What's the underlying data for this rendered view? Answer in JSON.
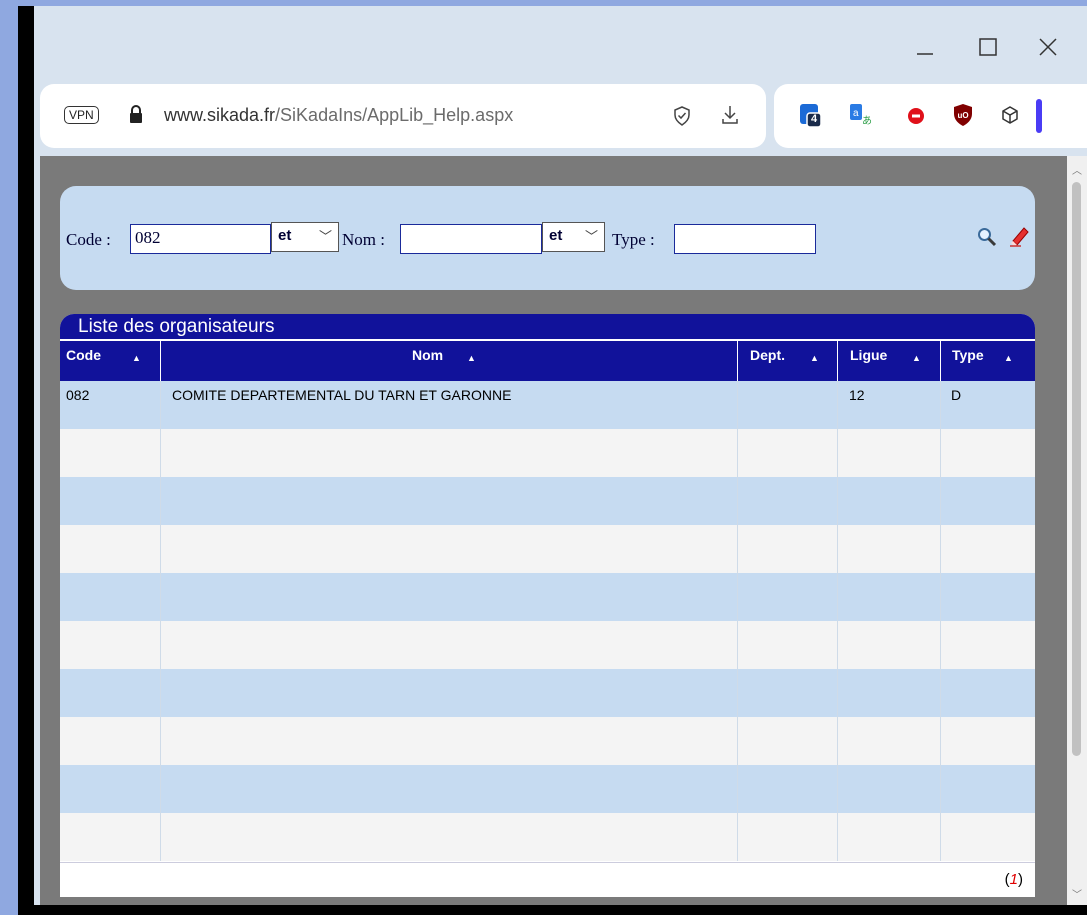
{
  "browser": {
    "vpn_label": "VPN",
    "url_host": "www.sikada.fr",
    "url_path": "/SiKadaIns/AppLib_Help.aspx",
    "tab_count_badge": "4",
    "window_controls": [
      "minimize-icon",
      "maximize-icon",
      "close-icon"
    ],
    "extension_icons": [
      "tab-counter-icon",
      "translate-icon",
      "record-icon",
      "ublock-icon",
      "cube-icon"
    ]
  },
  "search": {
    "code_label": "Code :",
    "code_value": "082",
    "op1_value": "et",
    "nom_label": "Nom :",
    "nom_value": "",
    "op2_value": "et",
    "type_label": "Type :",
    "type_value": ""
  },
  "list": {
    "title": "Liste des organisateurs",
    "columns": [
      "Code",
      "Nom",
      "Dept.",
      "Ligue",
      "Type"
    ],
    "rows": [
      {
        "code": "082",
        "nom": "COMITE DEPARTEMENTAL DU TARN ET GARONNE",
        "dept": "",
        "ligue": "12",
        "type": "D"
      }
    ],
    "pager": "1"
  },
  "colors": {
    "header_blue": "#11129a",
    "row_blue": "#c6dbf1",
    "pager_red": "#e00000"
  }
}
